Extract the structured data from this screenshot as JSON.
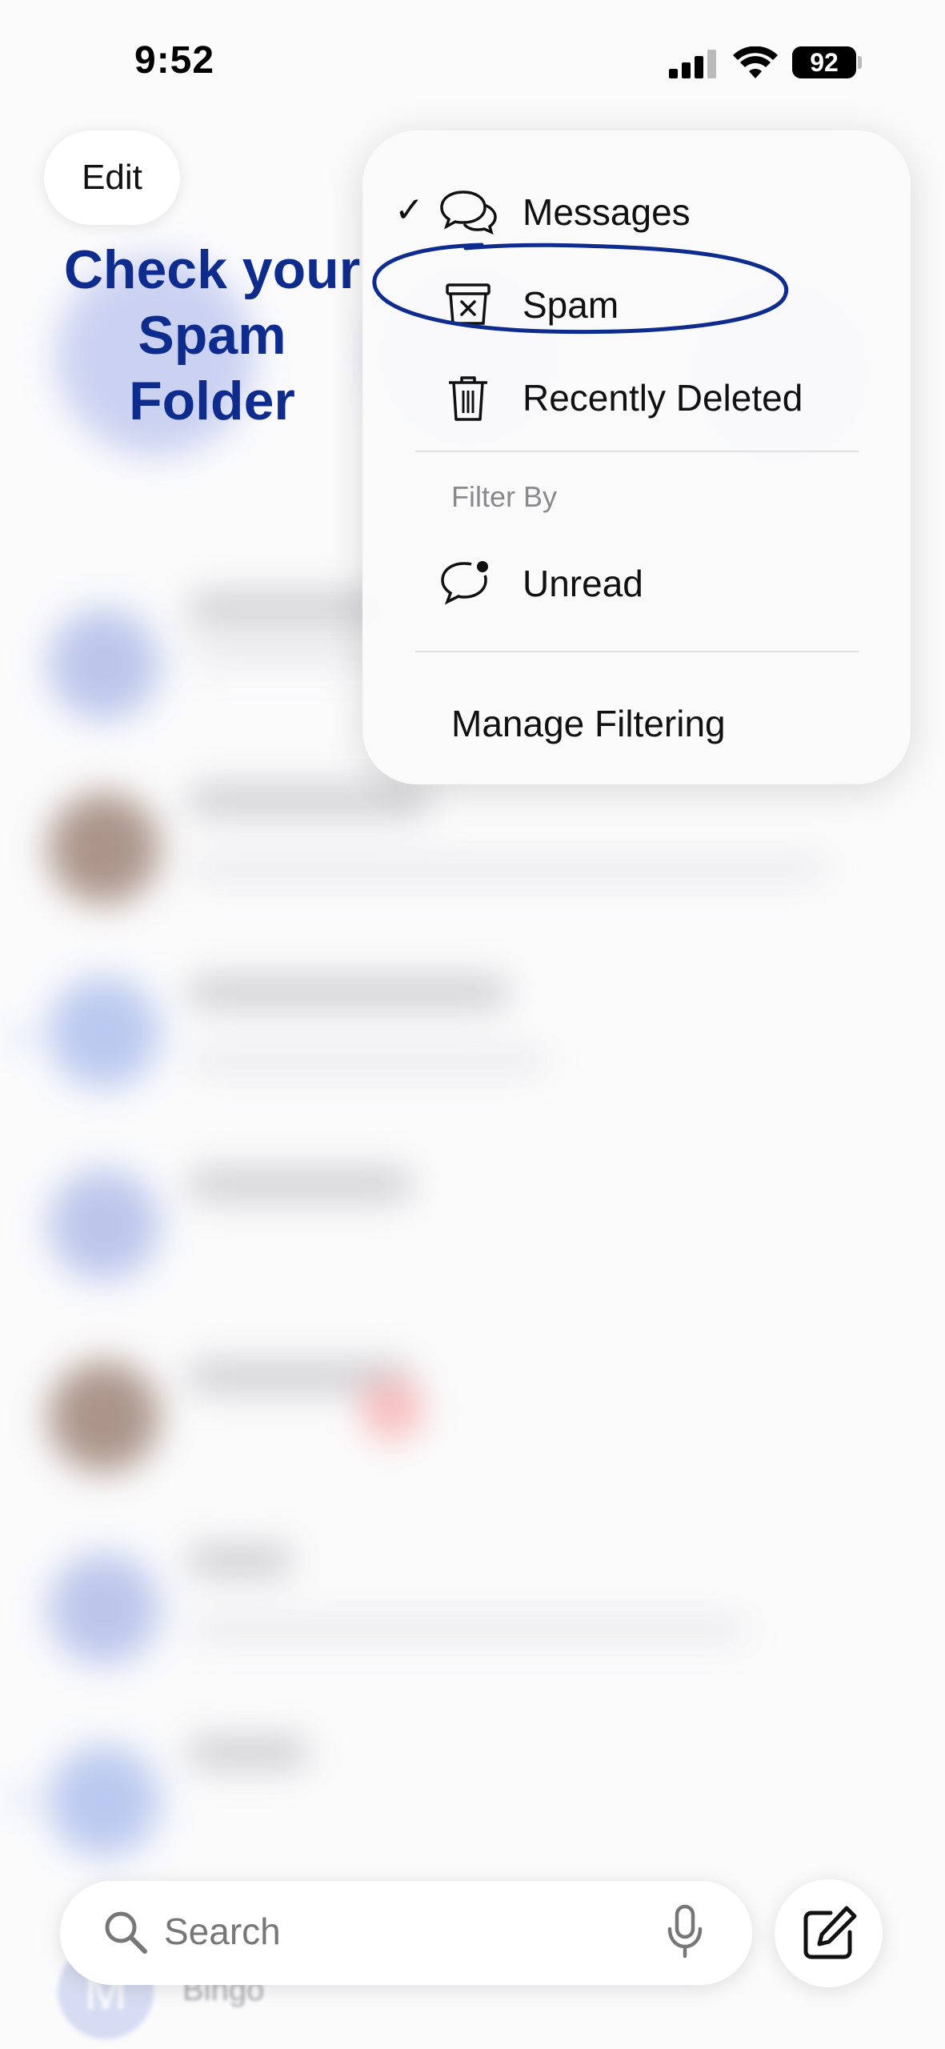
{
  "status_bar": {
    "time": "9:52",
    "battery": "92"
  },
  "header": {
    "edit_label": "Edit"
  },
  "annotation": {
    "lines": [
      "Check your",
      "Spam",
      "Folder"
    ]
  },
  "menu": {
    "messages_label": "Messages",
    "spam_label": "Spam",
    "recently_deleted_label": "Recently Deleted",
    "filter_by_label": "Filter By",
    "unread_label": "Unread",
    "manage_filtering_label": "Manage Filtering",
    "selected": "Messages"
  },
  "search": {
    "placeholder": "Search"
  },
  "background_conversation": {
    "avatar_letter": "M",
    "name": "Bingo"
  },
  "colors": {
    "annotation": "#0e2c8e",
    "accent": "#4a86e8"
  }
}
